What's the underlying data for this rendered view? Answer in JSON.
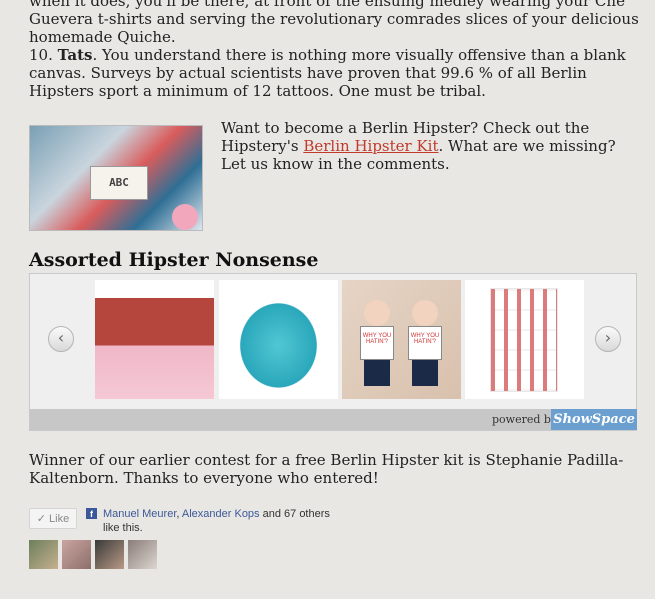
{
  "article": {
    "top_text": "when it does, you'll be there, at front of the ensuing medley wearing your Che Guevera t-shirts and serving the revolutionary comrades slices of your delicious homemade Quiche.",
    "tats_number": "10.",
    "tats_title": "Tats",
    "tats_text": ". You understand there is nothing more visually offensive than a blank canvas. Surveys by actual scientists have proven that 99.6 % of all Berlin Hipsters sport a minimum of 12 tattoos. One must be tribal.",
    "kit_intro": "Want to become a Berlin Hipster? Check out the Hipstery's",
    "kit_link": "Berlin Hipster Kit",
    "kit_outro": ". What are we missing? Let us know in the comments.",
    "kit_image_card": "ABC",
    "winner_text": "Winner of our earlier contest for a free Berlin Hipster kit is Stephanie Padilla-Kaltenborn. Thanks to everyone who entered!"
  },
  "carousel": {
    "title": "Assorted Hipster Nonsense",
    "prev_icon": "‹",
    "next_icon": "›",
    "doll_text": "WHY YOU HATIN'?",
    "powered_by": "powered by",
    "brand": "ShowSpace"
  },
  "facebook": {
    "like_label": "✓ Like",
    "fb_icon": "f",
    "liker_1": "Manuel Meurer",
    "separator": ", ",
    "liker_2": "Alexander Kops",
    "others_text": " and 67 others like this."
  }
}
